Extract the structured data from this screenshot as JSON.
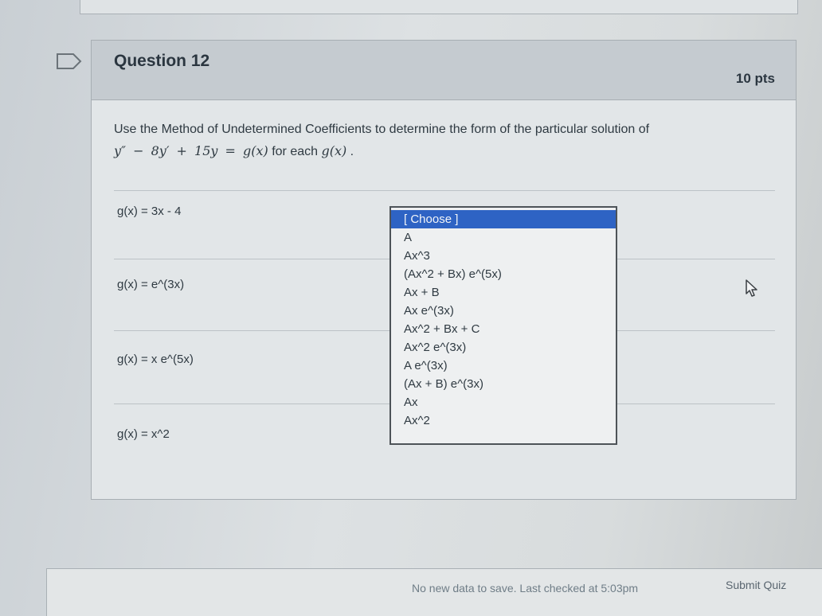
{
  "question": {
    "title": "Question 12",
    "points": "10 pts",
    "instruction": "Use the Method of Undetermined Coefficients to determine the form of the particular solution of",
    "equation_lhs": "y″ − 8y′ + 15y = g(x)",
    "equation_tail": "for each",
    "equation_func": "g(x)",
    "equation_end": "."
  },
  "rows": [
    {
      "label": "g(x) = 3x - 4"
    },
    {
      "label": "g(x) = e^(3x)"
    },
    {
      "label": "g(x) = x e^(5x)"
    },
    {
      "label": "g(x) = x^2"
    }
  ],
  "dropdown": {
    "options": [
      "[ Choose ]",
      "A",
      "Ax^3",
      "(Ax^2 + Bx) e^(5x)",
      "Ax + B",
      "Ax e^(3x)",
      "Ax^2 + Bx + C",
      "Ax^2 e^(3x)",
      "A e^(3x)",
      "(Ax + B) e^(3x)",
      "Ax",
      "Ax^2"
    ]
  },
  "footer": {
    "status": "No new data to save. Last checked at 5:03pm",
    "submit_label": "Submit Quiz"
  },
  "colors": {
    "selected_option": "#2e63c4",
    "header_band": "#c5cbd0"
  }
}
